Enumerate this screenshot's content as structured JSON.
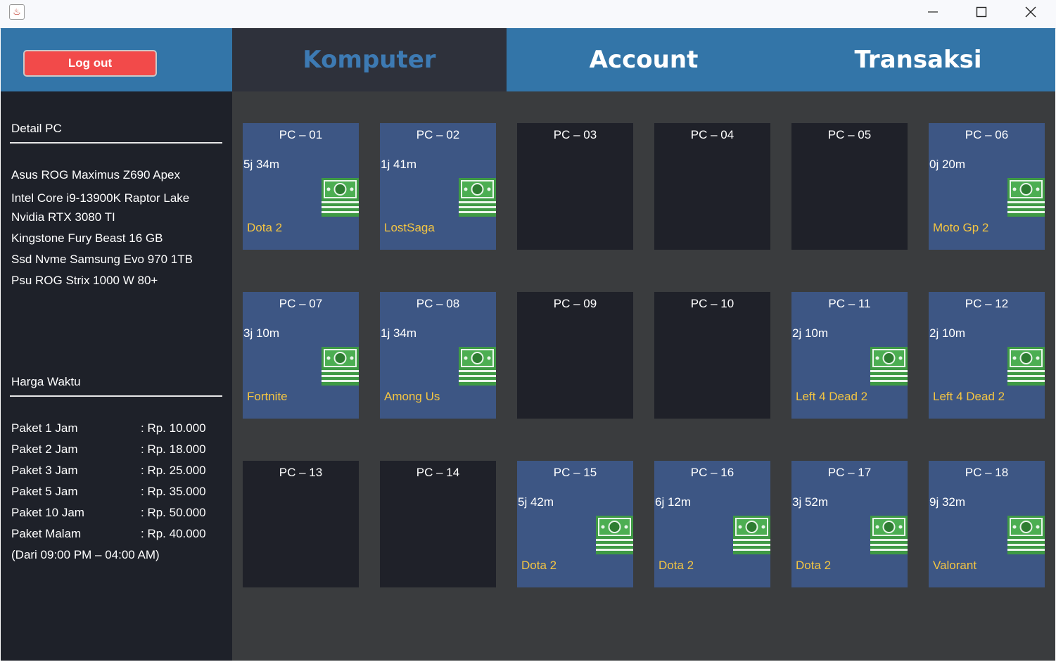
{
  "window": {
    "app_icon": "java-cup-icon",
    "minimize_icon": "minimize-icon",
    "maximize_icon": "maximize-icon",
    "close_icon": "close-icon"
  },
  "header": {
    "logout_label": "Log out",
    "tabs": [
      {
        "label": "Komputer",
        "active": true
      },
      {
        "label": "Account",
        "active": false
      },
      {
        "label": "Transaksi",
        "active": false
      }
    ]
  },
  "sidebar": {
    "detail_title": "Detail PC",
    "specs": [
      "Asus ROG Maximus Z690 Apex",
      "Intel Core i9-13900K Raptor Lake",
      "Nvidia RTX 3080 TI",
      "Kingstone Fury Beast 16 GB",
      "Ssd Nvme Samsung Evo 970 1TB",
      "Psu ROG Strix 1000 W 80+"
    ],
    "price_title": "Harga Waktu",
    "prices": [
      {
        "name": "Paket 1 Jam",
        "value": ": Rp. 10.000"
      },
      {
        "name": "Paket 2 Jam",
        "value": ": Rp. 18.000"
      },
      {
        "name": "Paket 3 Jam",
        "value": ": Rp. 25.000"
      },
      {
        "name": "Paket 5 Jam",
        "value": ": Rp. 35.000"
      },
      {
        "name": "Paket 10 Jam",
        "value": ": Rp. 50.000"
      },
      {
        "name": "Paket Malam",
        "value": ": Rp. 40.000"
      }
    ],
    "night_note": "(Dari 09:00 PM – 04:00 AM)"
  },
  "colors": {
    "header_blue": "#3375a8",
    "active_tab_bg": "#2e313b",
    "active_tab_text": "#3d7ab3",
    "pc_active": "#3d5684",
    "pc_idle": "#1f2129",
    "game_text": "#f4c542",
    "logout_red": "#f24a4a"
  },
  "pcs": [
    {
      "name": "PC – 01",
      "time": "5j 34m",
      "game": "Dota 2",
      "active": true
    },
    {
      "name": "PC – 02",
      "time": "1j 41m",
      "game": "LostSaga",
      "active": true
    },
    {
      "name": "PC – 03",
      "time": "",
      "game": "",
      "active": false
    },
    {
      "name": "PC – 04",
      "time": "",
      "game": "",
      "active": false
    },
    {
      "name": "PC – 05",
      "time": "",
      "game": "",
      "active": false
    },
    {
      "name": "PC – 06",
      "time": "0j 20m",
      "game": "Moto Gp 2",
      "active": true
    },
    {
      "name": "PC – 07",
      "time": "3j 10m",
      "game": "Fortnite",
      "active": true
    },
    {
      "name": "PC – 08",
      "time": "1j 34m",
      "game": "Among Us",
      "active": true
    },
    {
      "name": "PC – 09",
      "time": "",
      "game": "",
      "active": false
    },
    {
      "name": "PC – 10",
      "time": "",
      "game": "",
      "active": false
    },
    {
      "name": "PC – 11",
      "time": "2j 10m",
      "game": "Left 4 Dead 2",
      "active": true
    },
    {
      "name": "PC – 12",
      "time": "2j 10m",
      "game": "Left 4 Dead 2",
      "active": true
    },
    {
      "name": "PC – 13",
      "time": "",
      "game": "",
      "active": false
    },
    {
      "name": "PC – 14",
      "time": "",
      "game": "",
      "active": false
    },
    {
      "name": "PC – 15",
      "time": "5j 42m",
      "game": "Dota 2",
      "active": true
    },
    {
      "name": "PC – 16",
      "time": "6j 12m",
      "game": "Dota 2",
      "active": true
    },
    {
      "name": "PC – 17",
      "time": "3j 52m",
      "game": "Dota 2",
      "active": true
    },
    {
      "name": "PC – 18",
      "time": "9j 32m",
      "game": "Valorant",
      "active": true
    }
  ]
}
